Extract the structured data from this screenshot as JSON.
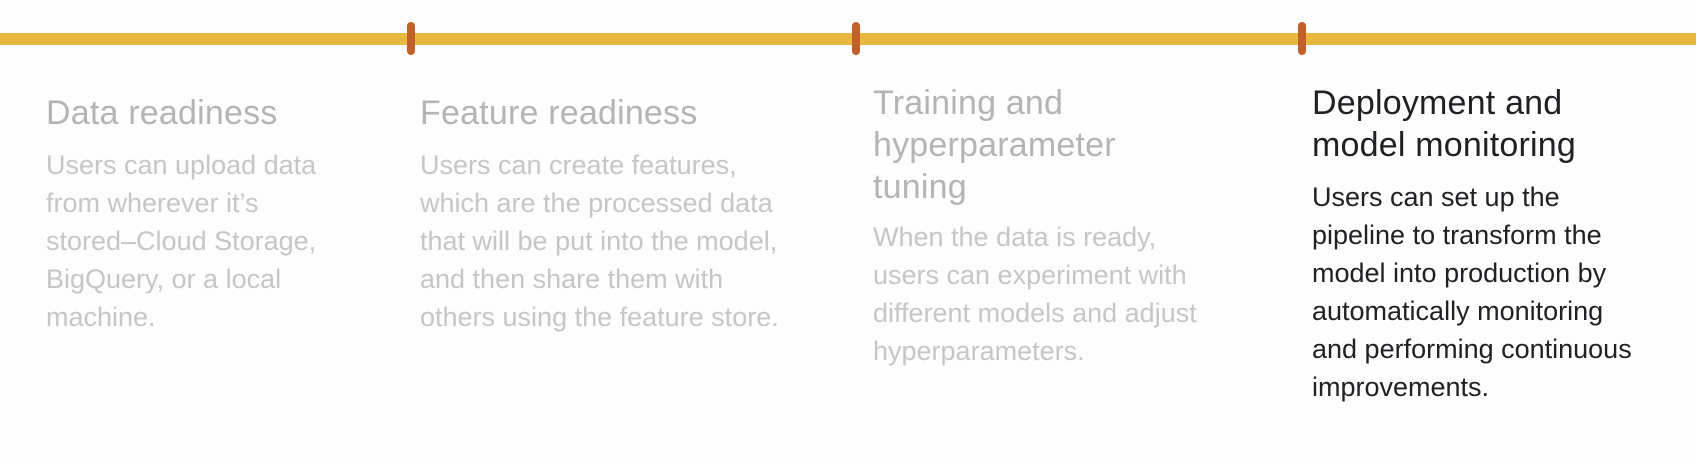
{
  "colors": {
    "timeline_bar": "#e9b83e",
    "tick_marks": "#c0612a",
    "inactive_text": "#b4b4b4",
    "active_text": "#202124"
  },
  "stages": [
    {
      "title": "Data readiness",
      "description": "Users can upload data\nfrom wherever it’s\nstored–Cloud Storage,\nBigQuery, or a local\nmachine.",
      "active": false
    },
    {
      "title": "Feature readiness",
      "description": "Users can create features,\nwhich are the processed data\nthat will be put into the model,\nand then share them with\nothers using the feature store.",
      "active": false
    },
    {
      "title": "Training and\nhyperparameter\ntuning",
      "description": "When the data is ready,\nusers can experiment with\ndifferent models and adjust\nhyperparameters.",
      "active": false
    },
    {
      "title": "Deployment and\nmodel monitoring",
      "description": "Users can set up the\npipeline to transform the\nmodel into production by\nautomatically monitoring\nand performing continuous\nimprovements.",
      "active": true
    }
  ]
}
